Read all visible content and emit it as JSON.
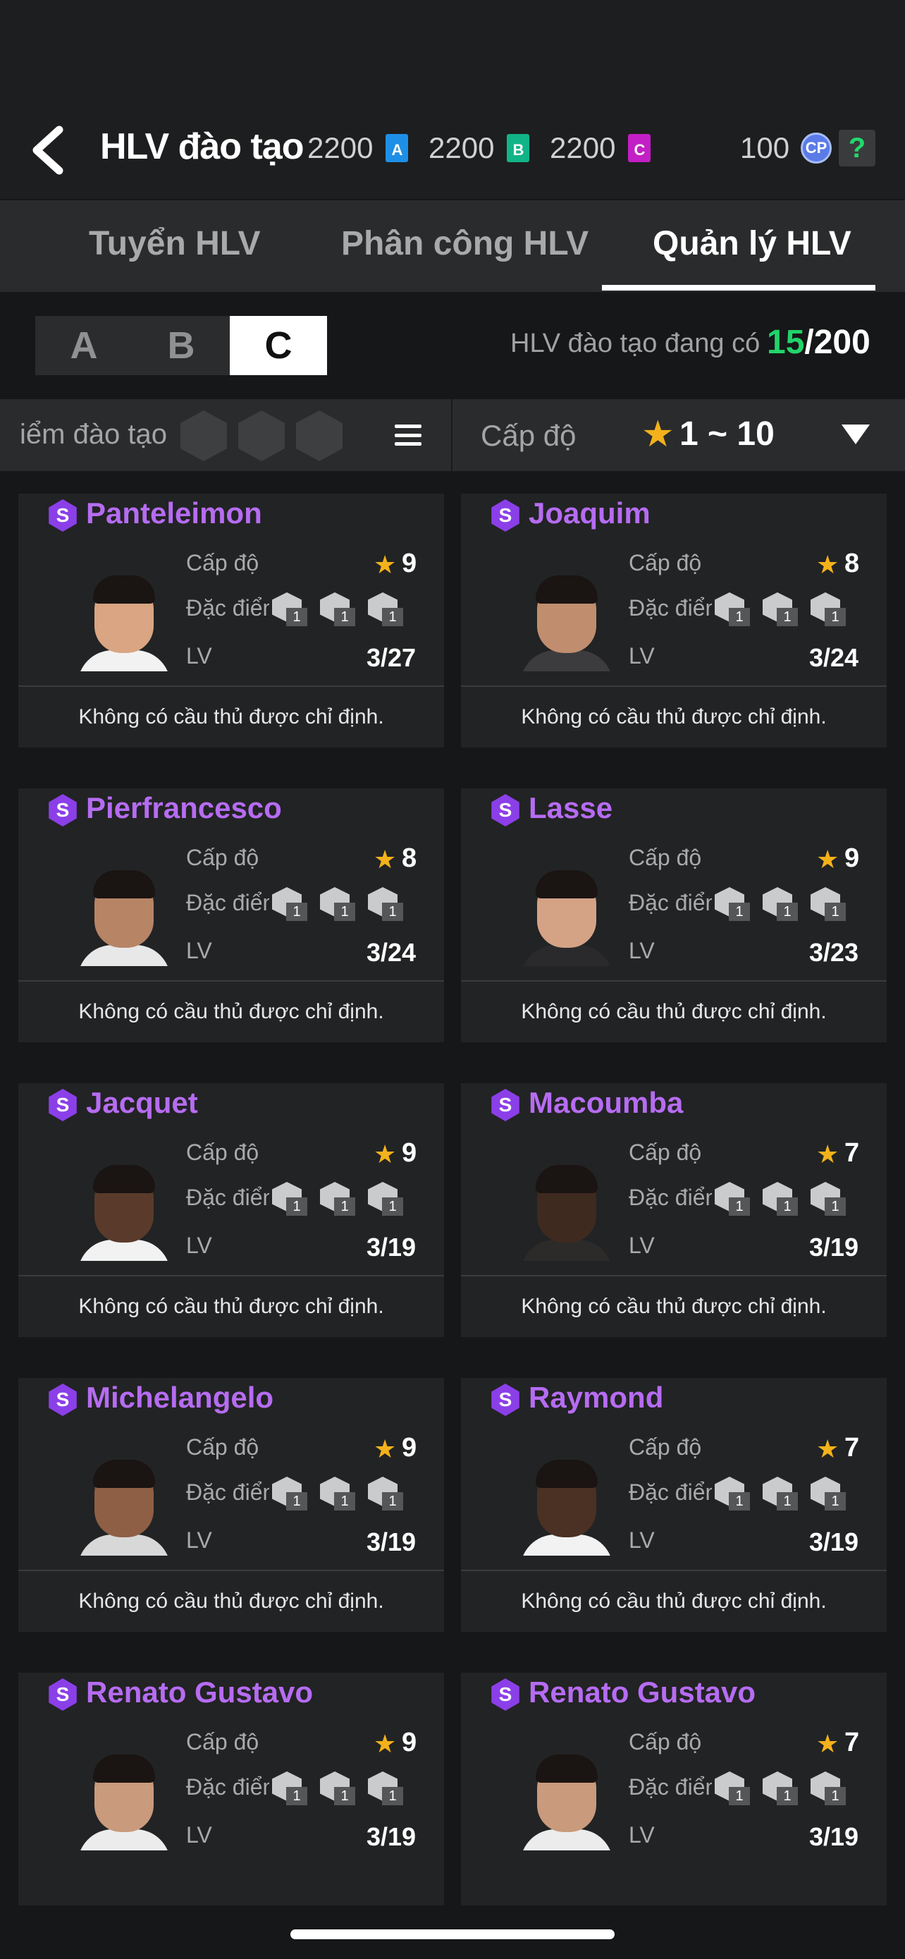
{
  "header": {
    "title": "HLV đào tạo",
    "currencies": [
      {
        "value": "2200",
        "badge": "A",
        "color": "#1e8fe6"
      },
      {
        "value": "2200",
        "badge": "B",
        "color": "#11b487"
      },
      {
        "value": "2200",
        "badge": "C",
        "color": "#c21fc6"
      }
    ],
    "cp_value": "100",
    "cp_badge": "CP",
    "help_label": "?"
  },
  "tabs": [
    {
      "label": "Tuyển HLV",
      "active": false
    },
    {
      "label": "Phân công HLV",
      "active": false
    },
    {
      "label": "Quản lý HLV",
      "active": true
    }
  ],
  "groups": [
    {
      "label": "A",
      "selected": false
    },
    {
      "label": "B",
      "selected": false
    },
    {
      "label": "C",
      "selected": true
    }
  ],
  "count": {
    "label": "HLV đào tạo đang có",
    "current": "15",
    "total": "/200"
  },
  "filter": {
    "traits_label": "iểm đào tạo",
    "level_label": "Cấp độ",
    "level_range": "1 ~ 10"
  },
  "card_labels": {
    "level": "Cấp độ",
    "traits": "Đặc điểm",
    "lv": "LV",
    "badge": "S"
  },
  "coaches": [
    {
      "name": "Panteleimon",
      "level": "9",
      "lv": "3/27",
      "footer": "Không có cầu thủ được chỉ định.",
      "traits": [
        "1",
        "1",
        "1"
      ],
      "skin": "#d9a582",
      "shirt": "#f2f2f2"
    },
    {
      "name": "Joaquim",
      "level": "8",
      "lv": "3/24",
      "footer": "Không có cầu thủ được chỉ định.",
      "traits": [
        "1",
        "1",
        "1"
      ],
      "skin": "#c08e6f",
      "shirt": "#3c3c3e"
    },
    {
      "name": "Pierfrancesco",
      "level": "8",
      "lv": "3/24",
      "footer": "Không có cầu thủ được chỉ định.",
      "traits": [
        "1",
        "1",
        "1"
      ],
      "skin": "#b78466",
      "shirt": "#e8e8e8"
    },
    {
      "name": "Lasse",
      "level": "9",
      "lv": "3/23",
      "footer": "Không có cầu thủ được chỉ định.",
      "traits": [
        "1",
        "1",
        "1"
      ],
      "skin": "#d4a386",
      "shirt": "#2a2a2c"
    },
    {
      "name": "Jacquet",
      "level": "9",
      "lv": "3/19",
      "footer": "Không có cầu thủ được chỉ định.",
      "traits": [
        "1",
        "1",
        "1"
      ],
      "skin": "#5a3b2b",
      "shirt": "#f2f2f2"
    },
    {
      "name": "Macoumba",
      "level": "7",
      "lv": "3/19",
      "footer": "Không có cầu thủ được chỉ định.",
      "traits": [
        "1",
        "1",
        "1"
      ],
      "skin": "#3f2a20",
      "shirt": "#2d2b2a"
    },
    {
      "name": "Michelangelo",
      "level": "9",
      "lv": "3/19",
      "footer": "Không có cầu thủ được chỉ định.",
      "traits": [
        "1",
        "1",
        "1"
      ],
      "skin": "#8e5f45",
      "shirt": "#d8d8d8"
    },
    {
      "name": "Raymond",
      "level": "7",
      "lv": "3/19",
      "footer": "Không có cầu thủ được chỉ định.",
      "traits": [
        "1",
        "1",
        "1"
      ],
      "skin": "#4b3024",
      "shirt": "#f2f2f2"
    },
    {
      "name": "Renato Gustavo",
      "level": "9",
      "lv": "3/19",
      "footer": "",
      "traits": [
        "1",
        "1",
        "1"
      ],
      "skin": "#c99a7c",
      "shirt": "#ececec"
    },
    {
      "name": "Renato Gustavo",
      "level": "7",
      "lv": "3/19",
      "footer": "",
      "traits": [
        "1",
        "1",
        "1"
      ],
      "skin": "#c99a7c",
      "shirt": "#ececec"
    }
  ]
}
